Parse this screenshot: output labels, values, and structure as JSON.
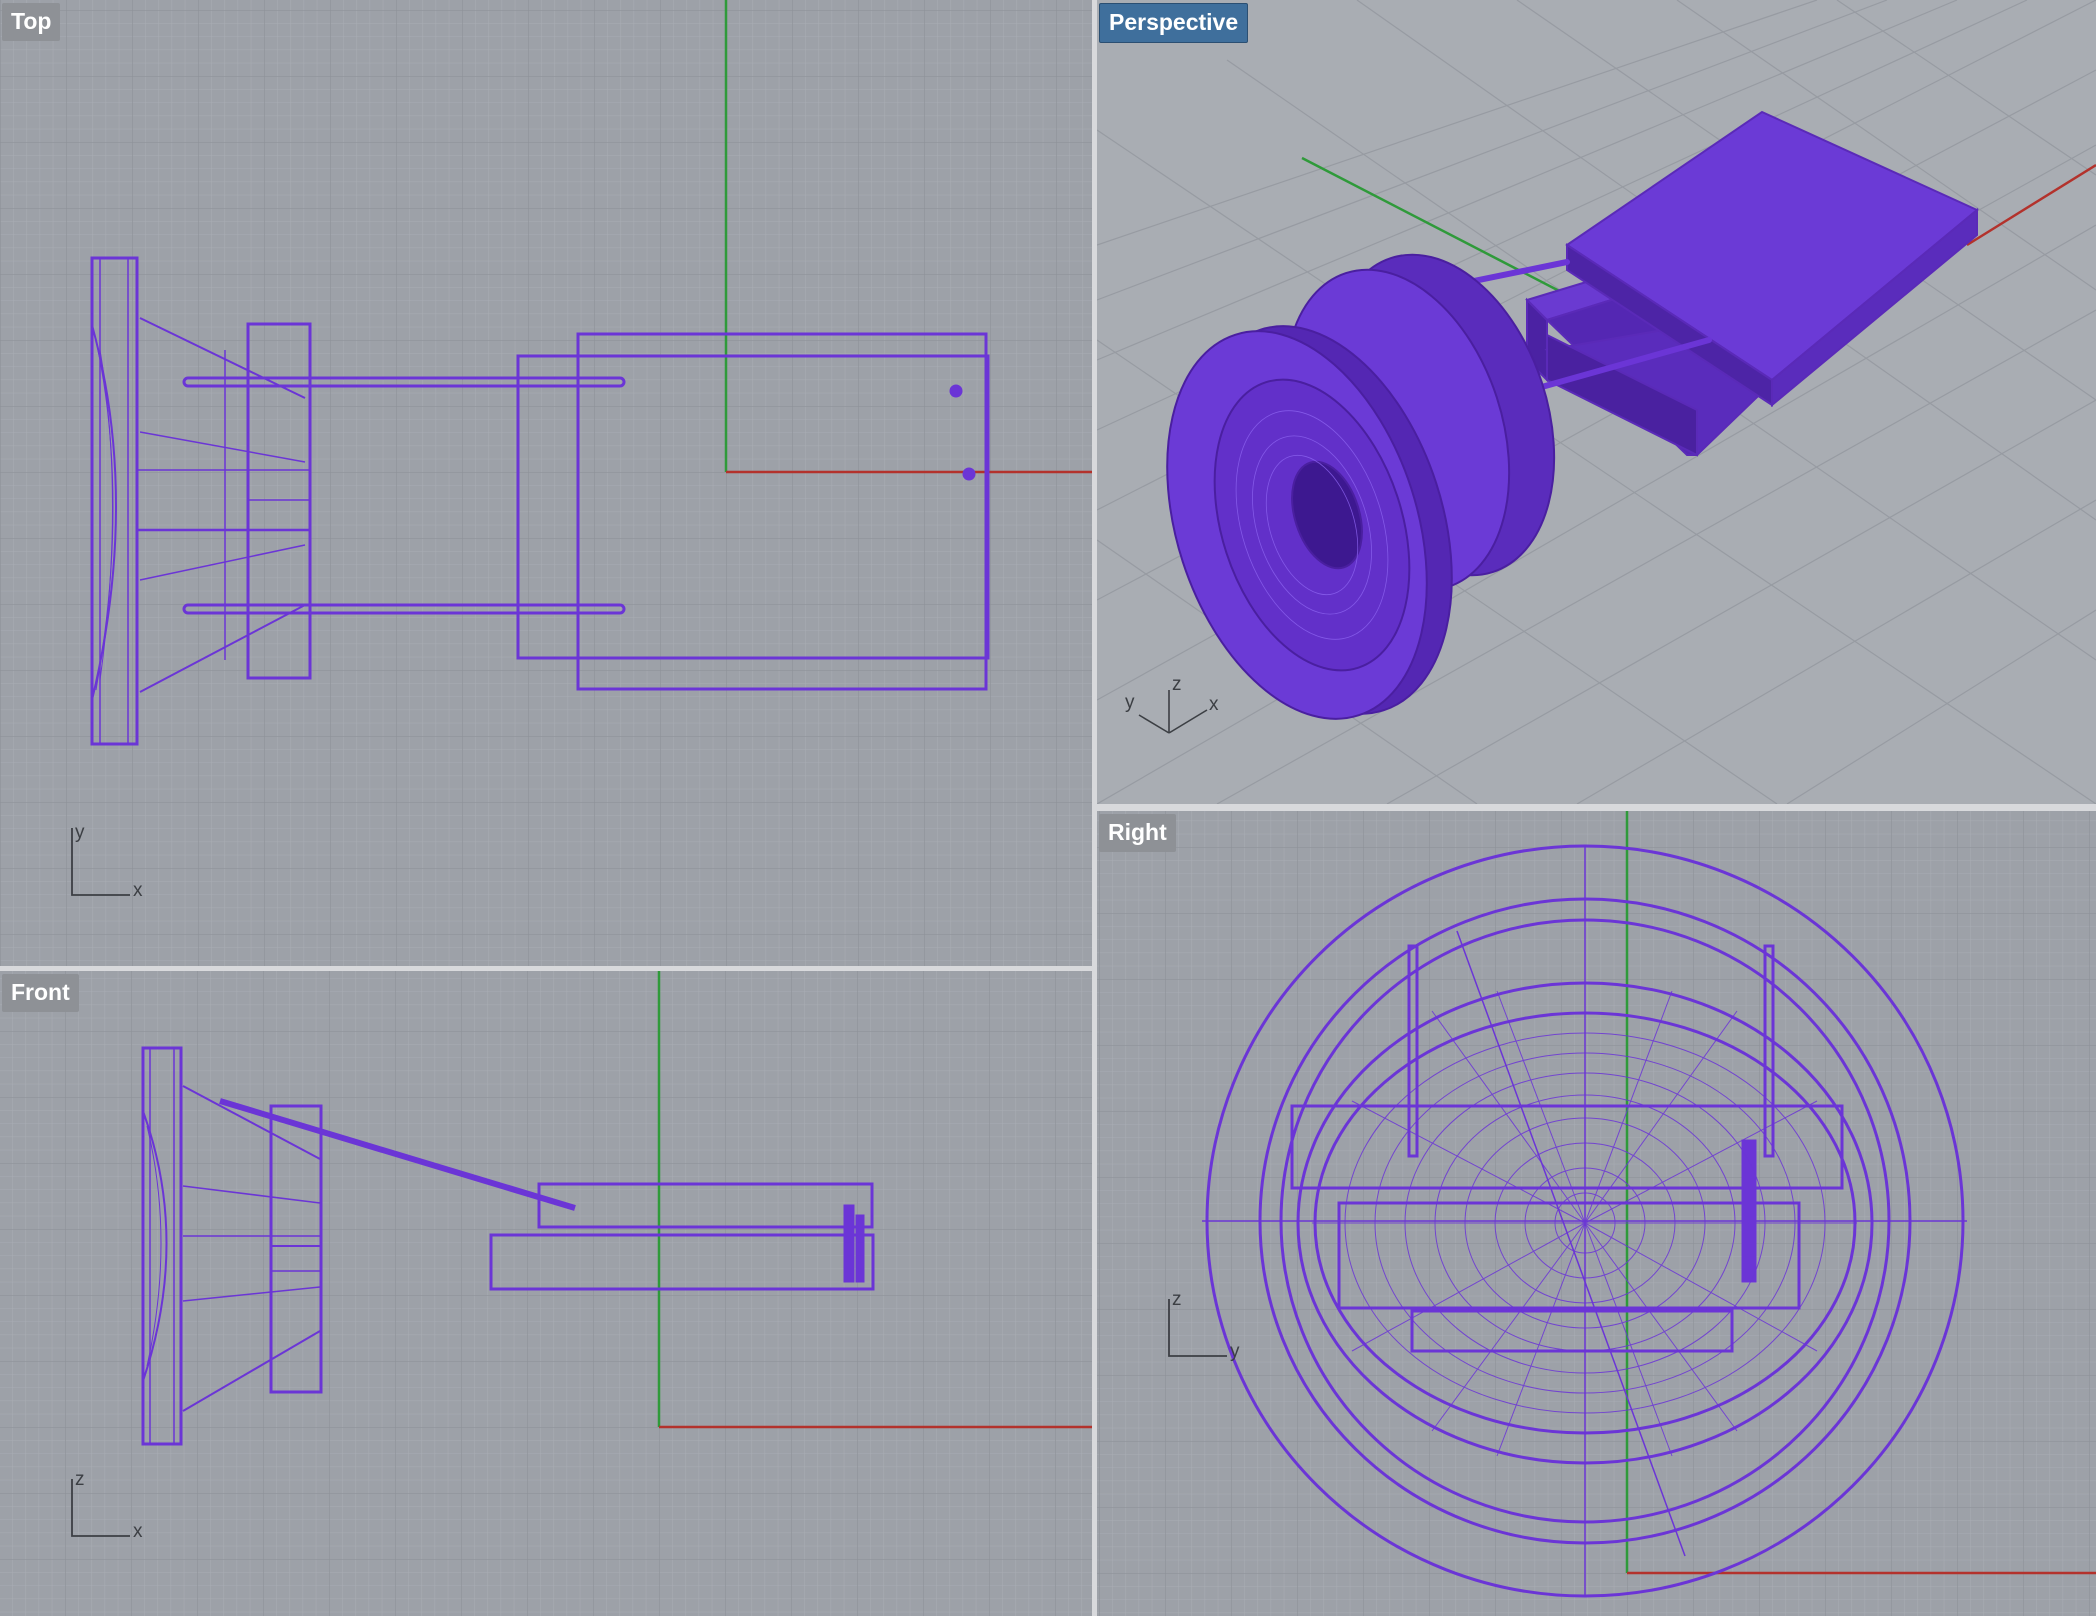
{
  "viewports": {
    "top": {
      "label": "Top",
      "axis_h": "x",
      "axis_v": "y"
    },
    "perspective": {
      "label": "Perspective",
      "axes": [
        "y",
        "z",
        "x"
      ]
    },
    "front": {
      "label": "Front",
      "axis_h": "x",
      "axis_v": "z"
    },
    "right": {
      "label": "Right",
      "axis_h": "y",
      "axis_v": "z"
    }
  },
  "colors": {
    "viewport_bg": "#9da1a8",
    "grid_minor": "#a7abb2",
    "grid_major": "#8f939a",
    "geometry": "#6b35d6",
    "x_axis": "#b3322c",
    "y_axis": "#2f9a3a",
    "active_label": "#3f6f9c",
    "inactive_label": "#8e9196"
  },
  "icons": [
    "axis-gizmo-icon"
  ]
}
